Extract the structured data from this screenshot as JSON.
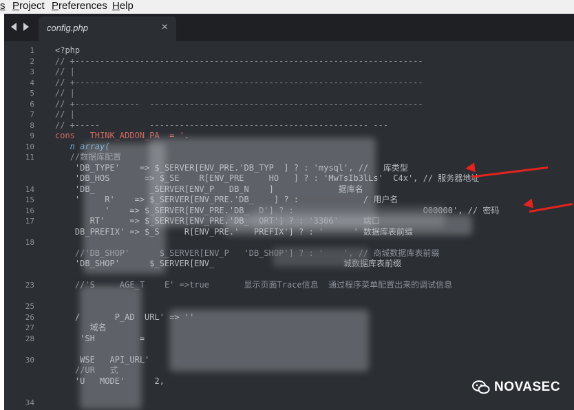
{
  "menubar": {
    "items": [
      "s",
      "Project",
      "Preferences",
      "Help"
    ]
  },
  "tab": {
    "label": "config.php",
    "close": "×"
  },
  "lines": [
    {
      "n": "1",
      "t": "<?php"
    },
    {
      "n": "2",
      "t": "// +----------------------------------------------------------------------"
    },
    {
      "n": "3",
      "t": "// |"
    },
    {
      "n": "4",
      "t": "// +----------------------------------------------------------------------"
    },
    {
      "n": "5",
      "t": "// |"
    },
    {
      "n": "6",
      "t": "// +-------------  -------------------------------------------------------"
    },
    {
      "n": "7",
      "t": "// |"
    },
    {
      "n": "8",
      "t": "// +-----          -------------------------------------------- ---"
    },
    {
      "n": "9",
      "t": "cons   THINK_ADDON_PA  = '."
    },
    {
      "n": "10",
      "t": "   n array("
    },
    {
      "n": "11",
      "t": "   //数据库配置"
    },
    {
      "n": "",
      "t": "    'DB_TYPE'    => $_SERVER[ENV_PRE.'DB_TYP  ] ? : 'mysql', //   库类型"
    },
    {
      "n": "",
      "t": "    'DB_HOS       => $_SE    R[ENV_PRE     HO   ] ? : 'MwTsIb3lLs'  C4x', // 服务器地址"
    },
    {
      "n": "14",
      "t": "    'DB_           _SERVER[ENV_P   DB_N    ]             据库名"
    },
    {
      "n": "15",
      "t": "    '     R'    => $_SERVER[ENV_PRE.'DB_    ] ? :             / 用户名"
    },
    {
      "n": "16",
      "t": "          '    => $_SERVER[ENV_PRE.'DB_  D'] ? :                          O00000', // 密码"
    },
    {
      "n": "17",
      "t": "       RT'     => $_SERVER[ENV_PRE.'DB_  ORT'] ? : '3306'     端口"
    },
    {
      "n": "",
      "t": "    DB_PREFIX' => $_S     R[ENV_PRE.'   PREFIX'] ? : '      ' 数据库表前缀"
    },
    {
      "n": "18",
      "t": ""
    },
    {
      "n": "",
      "t": "    //'DB_SHOP'      $_SERVER[ENV_P   'DB_SHOP'] ? : '    ', // 商城数据库表前缀"
    },
    {
      "n": "",
      "t": "    'DB_SHOP'      $_SERVER[ENV_                          城数据库表前缀"
    },
    {
      "n": "",
      "t": ""
    },
    {
      "n": "23",
      "t": "    //'S     AGE_T    E' =>true       显示页面Trace信息  通过程序菜单配置出来的调试信息"
    },
    {
      "n": "",
      "t": ""
    },
    {
      "n": "25",
      "t": ""
    },
    {
      "n": "26",
      "t": "    /       P_AD  URL' => ''"
    },
    {
      "n": "27",
      "t": "       域名"
    },
    {
      "n": "28",
      "t": "     'SH         ="
    },
    {
      "n": "",
      "t": ""
    },
    {
      "n": "30",
      "t": "     WSE   API_URL'"
    },
    {
      "n": "",
      "t": "    //UR   式"
    },
    {
      "n": "",
      "t": "    'U   MODE'      2,"
    },
    {
      "n": "",
      "t": ""
    },
    {
      "n": "34",
      "t": ""
    },
    {
      "n": "",
      "t": ""
    }
  ],
  "watermark": {
    "text": "NOVASEC",
    "icon": "wechat-icon"
  }
}
